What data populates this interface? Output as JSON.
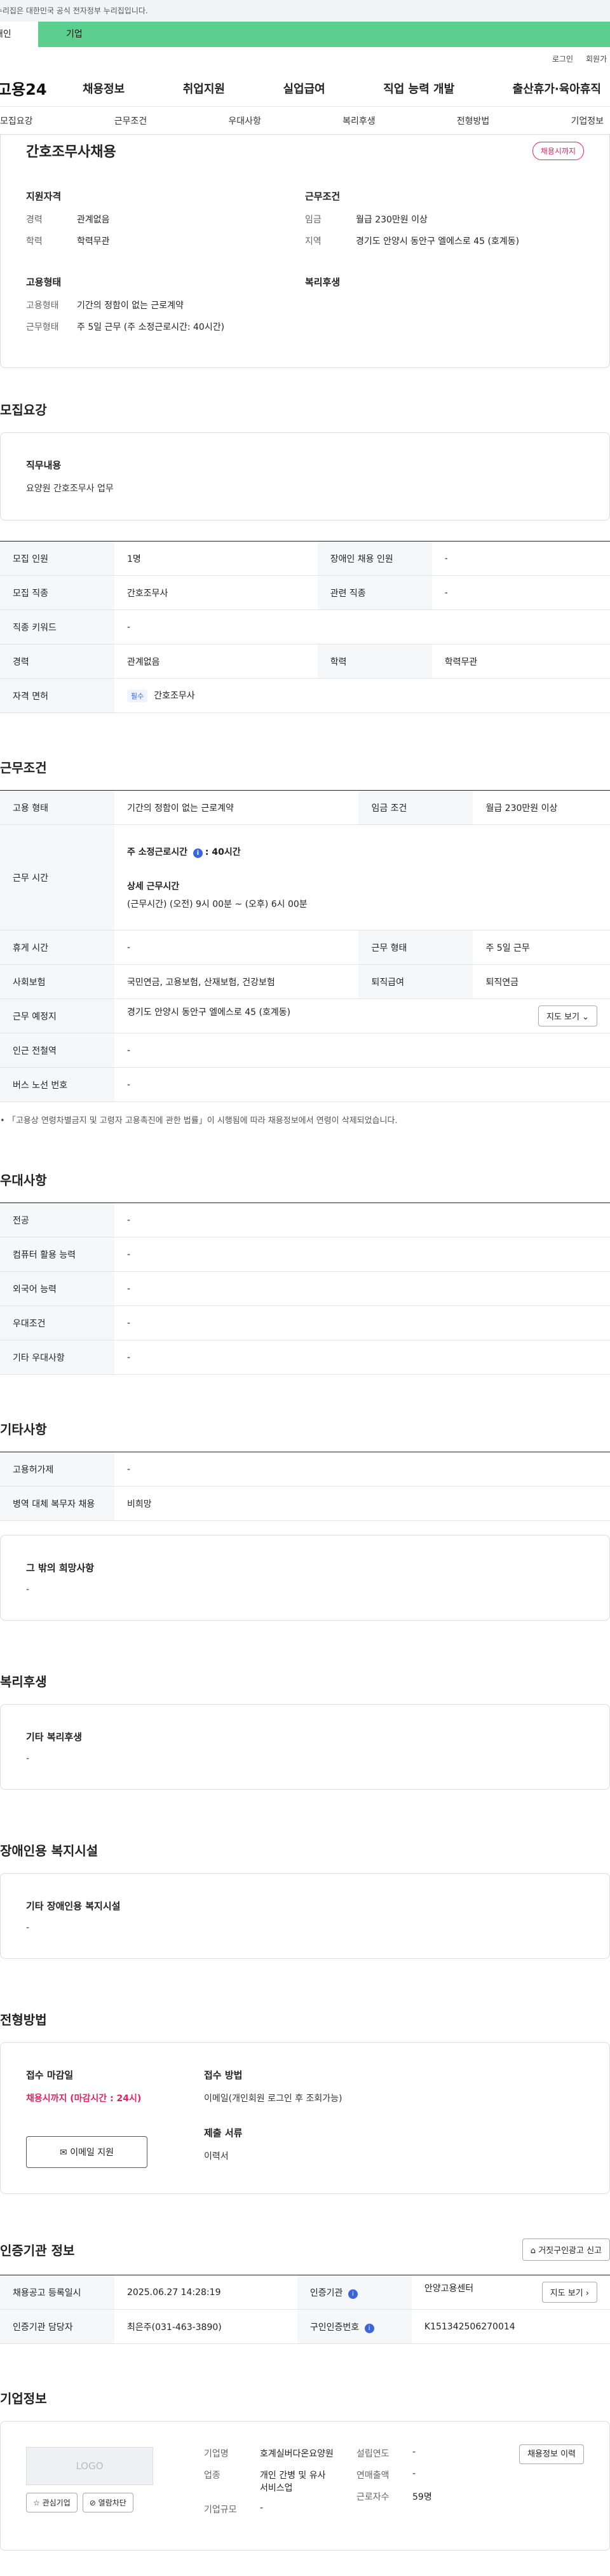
{
  "gov_notice": "이 누리집은 대한민국 공식 전자정부 누리집입니다.",
  "top_tabs": {
    "individual": "개인",
    "business": "기업"
  },
  "util": {
    "login": "로그인",
    "join": "회원가입"
  },
  "gnb": {
    "logo": "고용24",
    "menu": [
      "채용정보",
      "취업지원",
      "실업급여",
      "직업 능력 개발",
      "출산휴가·육아휴직"
    ]
  },
  "anchors": [
    "모집요강",
    "근무조건",
    "우대사항",
    "복리후생",
    "전형방법",
    "기업정보"
  ],
  "summary": {
    "title": "간호조무사채용",
    "badge": "채용시까지",
    "qual_heading": "지원자격",
    "qual": [
      {
        "k": "경력",
        "v": "관계없음"
      },
      {
        "k": "학력",
        "v": "학력무관"
      }
    ],
    "cond_heading": "근무조건",
    "cond": [
      {
        "k": "임금",
        "v": "월급 230만원 이상"
      },
      {
        "k": "지역",
        "v": "경기도 안양시 동안구 엘에스로 45 (호계동)"
      }
    ],
    "emp_heading": "고용형태",
    "emp": [
      {
        "k": "고용형태",
        "v": "기간의 정함이 없는 근로계약"
      },
      {
        "k": "근무형태",
        "v": "주 5일 근무 (주 소정근로시간: 40시간)"
      }
    ],
    "welfare_heading": "복리후생"
  },
  "recruit": {
    "title": "모집요강",
    "duty_label": "직무내용",
    "duty_value": "요양원 간호조무사 업무",
    "rows": {
      "headcount_k": "모집 인원",
      "headcount_v": "1명",
      "disabled_k": "장애인 채용 인원",
      "disabled_v": "-",
      "job_k": "모집 직종",
      "job_v": "간호조무사",
      "related_k": "관련 직종",
      "related_v": "-",
      "keyword_k": "직종 키워드",
      "keyword_v": "-",
      "career_k": "경력",
      "career_v": "관계없음",
      "edu_k": "학력",
      "edu_v": "학력무관",
      "license_k": "자격 면허",
      "license_tag": "필수",
      "license_v": "간호조무사"
    }
  },
  "work": {
    "title": "근무조건",
    "emp_k": "고용 형태",
    "emp_v": "기간의 정함이 없는 근로계약",
    "wage_k": "임금 조건",
    "wage_v": "월급 230만원 이상",
    "hours_k": "근무 시간",
    "hours_week_prefix": "주 소정근로시간",
    "hours_week_suffix": ": 40시간",
    "hours_detail_label": "상세 근무시간",
    "hours_detail_value": "(근무시간) (오전) 9시 00분 ~ (오후) 6시 00분",
    "rest_k": "휴게 시간",
    "rest_v": "-",
    "form_k": "근무 형태",
    "form_v": "주 5일 근무",
    "ins_k": "사회보험",
    "ins_v": "국민연금, 고용보험, 산재보험, 건강보험",
    "ret_k": "퇴직급여",
    "ret_v": "퇴직연금",
    "place_k": "근무 예정지",
    "place_v": "경기도 안양시 동안구 엘에스로 45 (호계동)",
    "map_btn": "지도 보기",
    "station_k": "인근 전철역",
    "station_v": "-",
    "bus_k": "버스 노선 번호",
    "bus_v": "-",
    "note": "「고용상 연령차별금지 및 고령자 고용촉진에 관한 법률」이 시행됨에 따라 채용정보에서 연령이 삭제되었습니다."
  },
  "pref": {
    "title": "우대사항",
    "rows": [
      {
        "k": "전공",
        "v": "-"
      },
      {
        "k": "컴퓨터 활용 능력",
        "v": "-"
      },
      {
        "k": "외국어 능력",
        "v": "-"
      },
      {
        "k": "우대조건",
        "v": "-"
      },
      {
        "k": "기타 우대사항",
        "v": "-"
      }
    ]
  },
  "etc": {
    "title": "기타사항",
    "rows": [
      {
        "k": "고용허가제",
        "v": "-"
      },
      {
        "k": "병역 대체 복무자 채용",
        "v": "비희망"
      }
    ],
    "other_label": "그 밖의 희망사항",
    "other_value": "-"
  },
  "welfare": {
    "title": "복리후생",
    "label": "기타 복리후생",
    "value": "-"
  },
  "disab": {
    "title": "장애인용 복지시설",
    "label": "기타 장애인용 복지시설",
    "value": "-"
  },
  "selection": {
    "title": "전형방법",
    "deadline_label": "접수 마감일",
    "deadline_value": "채용시까지 (마감시간 : 24시)",
    "email_btn": "이메일 지원",
    "method_label": "접수 방법",
    "method_value": "이메일(개인회원 로그인 후 조회가능)",
    "docs_label": "제출 서류",
    "docs_value": "이력서"
  },
  "cert": {
    "title": "인증기관 정보",
    "report_btn": "거짓구인광고 신고",
    "reg_k": "채용공고 등록일시",
    "reg_v": "2025.06.27 14:28:19",
    "org_k": "인증기관",
    "org_v": "안양고용센터",
    "map_btn": "지도 보기",
    "staff_k": "인증기관 담당자",
    "staff_v": "최은주(031-463-3890)",
    "num_k": "구인인증번호",
    "num_v": "K151342506270014"
  },
  "company": {
    "title": "기업정보",
    "logo": "LOGO",
    "fav_btn": "관심기업",
    "block_btn": "열람차단",
    "name_k": "기업명",
    "name_v": "호계실버다온요양원",
    "industry_k": "업종",
    "industry_v": "개인 간병 및 유사 서비스업",
    "size_k": "기업규모",
    "size_v": "-",
    "founded_k": "설립연도",
    "founded_v": "-",
    "revenue_k": "연매출액",
    "revenue_v": "-",
    "staff_k": "근로자수",
    "staff_v": "59명",
    "history_btn": "채용정보 이력"
  }
}
